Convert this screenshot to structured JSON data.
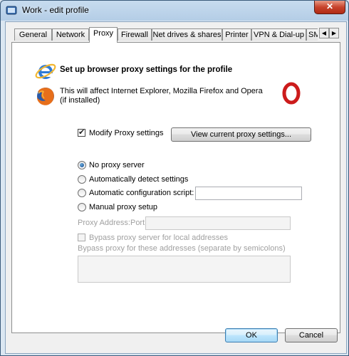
{
  "window": {
    "title": "Work - edit profile",
    "close_label": "✕"
  },
  "tabs": [
    "General",
    "Network",
    "Proxy",
    "Firewall",
    "Net drives & shares",
    "Printer",
    "VPN & Dial-up",
    "SMT"
  ],
  "tab_scroll": {
    "left": "◀",
    "right": "▶"
  },
  "proxy": {
    "heading": "Set up browser proxy settings for the profile",
    "description": "This will affect Internet Explorer, Mozilla Firefox and Opera (if installed)",
    "modify_label": "Modify Proxy settings",
    "view_button": "View current proxy settings...",
    "radio_no_proxy": "No proxy server",
    "radio_auto_detect": "Automatically detect settings",
    "radio_auto_script": "Automatic configuration script:",
    "radio_manual": "Manual proxy setup",
    "address_port_label": "Proxy Address:Port",
    "bypass_local_label": "Bypass proxy server for local addresses",
    "bypass_list_label": "Bypass proxy for these addresses (separate by semicolons)"
  },
  "footer": {
    "ok": "OK",
    "cancel": "Cancel"
  }
}
